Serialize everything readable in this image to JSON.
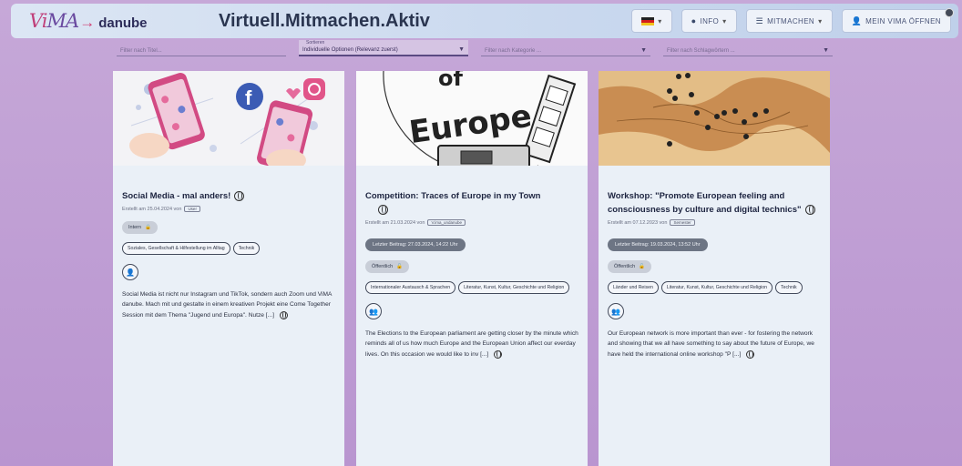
{
  "header": {
    "logo_vi": "Vi",
    "logo_ma": "MA",
    "logo_danube": "danube",
    "site_title": "Virtuell.Mitmachen.Aktiv",
    "nav": {
      "info": "INFO",
      "mitmachen": "MITMACHEN",
      "open": "MEIN VIMA ÖFFNEN"
    }
  },
  "filters": [
    {
      "text": "Filter nach Titel...",
      "active": false
    },
    {
      "text": "Individuelle Optionen (Relevanz zuerst)",
      "label": "Sortieren",
      "active": true
    },
    {
      "text": "Filter nach Kategorie ...",
      "active": false
    },
    {
      "text": "Filter nach Schlagwörtern ...",
      "active": false
    }
  ],
  "cards": [
    {
      "title": "Social Media - mal anders!",
      "meta": "Erstellt am 25.04.2024 von",
      "meta_chip": "User",
      "status": "Intern",
      "tags": [
        "Soziales, Gesellschaft & Hilfestellung im Alltag",
        "Technik"
      ],
      "desc": "Social Media ist nicht nur Instagram und TikTok, sondern auch Zoom und ViMA danube. Mach mit und gestalte in einem kreativen Projekt eine Come Together Session mit dem Thema \"Jugend und Europa\". Nutze [...]"
    },
    {
      "title": "Competition: Traces of Europe in my Town",
      "meta": "Erstellt am 21.03.2024 von",
      "meta_chip": "V.ima_undanube",
      "deadline": "Letzter Beitrag: 27.03.2024, 14:22 Uhr",
      "status": "Öffentlich",
      "tags": [
        "Internationaler Austausch & Sprachen",
        "Literatur, Kunst, Kultur, Geschichte und Religion"
      ],
      "desc": "The Elections to the European parliament are getting closer by the minute which reminds all of us how much Europe and the European Union affect our everday lives. On this occasion we would like to inv [...]",
      "img_text": "Europe"
    },
    {
      "title": "Workshop: \"Promote European feeling and consciousness by culture and digital technics\"",
      "meta": "Erstellt am 07.12.2023 von",
      "meta_chip": "Semester",
      "deadline": "Letzter Beitrag: 19.03.2024, 13:52 Uhr",
      "status": "Öffentlich",
      "tags": [
        "Länder und Reisen",
        "Literatur, Kunst, Kultur, Geschichte und Religion",
        "Technik"
      ],
      "desc": "Our European network is more important than ever - for fostering the network and showing that we all have something to say about the future of Europe, we have held the international online workshop \"P [...]"
    }
  ]
}
